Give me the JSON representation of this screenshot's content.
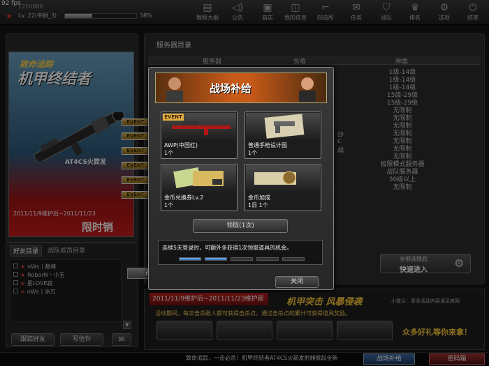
{
  "fps": "92 fps",
  "player": {
    "id": "1210866  ",
    "level": "Lv. 22(中尉_3)",
    "exp_percent": 38,
    "exp_text": "38%"
  },
  "nav": [
    {
      "label": "教程大纲",
      "icon": "book-icon"
    },
    {
      "label": "公告",
      "icon": "megaphone-icon"
    },
    {
      "label": "商店",
      "icon": "shop-icon"
    },
    {
      "label": "我的信息",
      "icon": "profile-icon"
    },
    {
      "label": "制造所",
      "icon": "gun-icon"
    },
    {
      "label": "任务",
      "icon": "mission-icon"
    },
    {
      "label": "战队",
      "icon": "shield-icon"
    },
    {
      "label": "排名",
      "icon": "trophy-icon"
    },
    {
      "label": "选项",
      "icon": "gear-icon"
    },
    {
      "label": "结束",
      "icon": "power-icon"
    }
  ],
  "promo": {
    "subtitle": "致命追踪",
    "title": "机甲终结者",
    "weapon": "AT4CS火箭发",
    "date": "2011/11/9维护后~2011/11/23",
    "limit": "限时销"
  },
  "friends": {
    "tabs": [
      "好友目录",
      "战队成员目录"
    ],
    "list": [
      "nWs丨巅峰",
      "RoborN丶小玉",
      "星LOVE寂",
      "nWs丨冰刃"
    ],
    "add_friend": "跟踪好友",
    "write_letter": "写信件"
  },
  "server": {
    "title": "服务器目录",
    "headers": [
      "服务器",
      "负载",
      "种类"
    ],
    "levels": [
      "1级-14级",
      "1级-14级",
      "1级-14级",
      "15级-29级",
      "15级-29级",
      "无限制",
      "无限制",
      "无限制",
      "无限制",
      "无限制",
      "无限制",
      "无限制",
      "极限模式服务器",
      "战队服务器",
      "30级以上",
      "无限制"
    ],
    "partial": [
      "沙",
      " ",
      "c",
      "战"
    ],
    "event_tag": "EVENT",
    "quick_top": "全部选择后",
    "quick_main": "快速进入"
  },
  "bottom_promo": {
    "date": "2011/11/9维护后~2011/11/23维护前",
    "title": "机甲突击 风暴侵袭",
    "tip": "小提示：更多活动内容请见官网",
    "desc": "活动期间，每次击杀敌人都可获得击杀点，通过击杀点的累计可获得道具奖励。",
    "gifts": "众多好礼等你来拿！"
  },
  "bottombar": {
    "ticker": "致命追踪，一击必杀！机甲终结者AT4CS火箭发射器掀起全新",
    "supply": "战场补给",
    "box": "密码箱"
  },
  "dialog": {
    "title": "战场补给",
    "items": [
      {
        "name": "AWP(中国红)",
        "qty": "1个",
        "badge": "EVENT"
      },
      {
        "name": "普通手枪设计图",
        "qty": "1个",
        "badge": ""
      },
      {
        "name": "金币兑换券Lv.2",
        "qty": "1个",
        "badge": ""
      },
      {
        "name": "金币加成",
        "qty": "1日 1个",
        "badge": ""
      }
    ],
    "claim": "领取(1次)",
    "login_text": "连续5天登录时，可额外多获得1次领取道具的机会。",
    "progress_done": 2,
    "progress_total": 5,
    "close": "关闭",
    "behind_btn": "战"
  },
  "colors": {
    "accent_orange": "#c85a18",
    "event_gold": "#e0b040",
    "promo_red": "#c81a1a",
    "gift_yellow": "#ffcc3a"
  }
}
